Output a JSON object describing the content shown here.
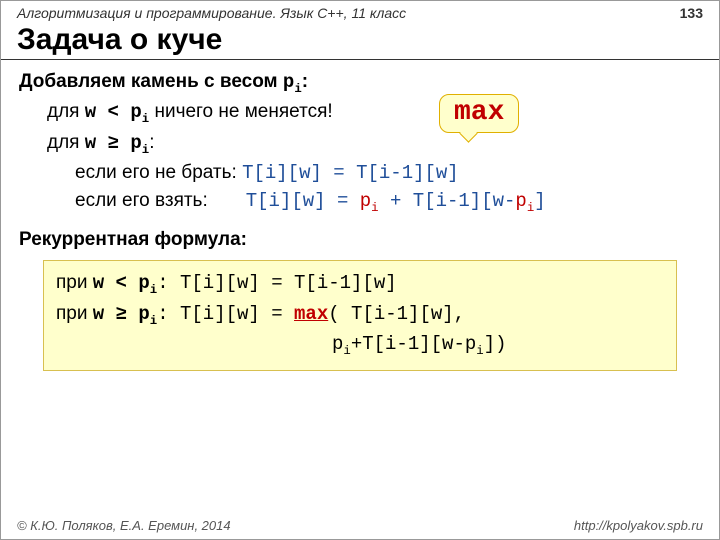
{
  "header": {
    "course": "Алгоритмизация и программирование. Язык C++, 11 класс",
    "page": "133"
  },
  "title": "Задача о куче",
  "body": {
    "heading_prefix": "Добавляем камень с весом ",
    "pi": "p",
    "pi_sub": "i",
    "colon": ":",
    "l2a": "для ",
    "l2b": "w < p",
    "l2c": " ничего не меняется!",
    "l3a": "для ",
    "l3b": "w ≥ p",
    "l3c": ":",
    "l4a": "если его не брать: ",
    "l4b": "T[i][w] = T[i-1][w]",
    "l5a": "если его взять:",
    "l5b_pre": "T[i][w] = ",
    "l5b_pi": "p",
    "l5b_mid": " + T[i-1][w-",
    "l5b_end": "]",
    "max": "max",
    "rec_heading": "Рекуррентная формула:"
  },
  "formula": {
    "f1a": "при ",
    "f1b": "w < p",
    "f1c": ": T[i][w] = T[i-1][w]",
    "f2a": "при ",
    "f2b": "w ≥ p",
    "f2c": ": T[i][w] = ",
    "f2_max": "max",
    "f2d": "( T[i-1][w],",
    "f3a": "p",
    "f3b": "+T[i-1][w-",
    "f3c": "p",
    "f3d": "])"
  },
  "footer": {
    "copyright": "© К.Ю. Поляков, Е.А. Еремин, 2014",
    "url": "http://kpolyakov.spb.ru"
  }
}
